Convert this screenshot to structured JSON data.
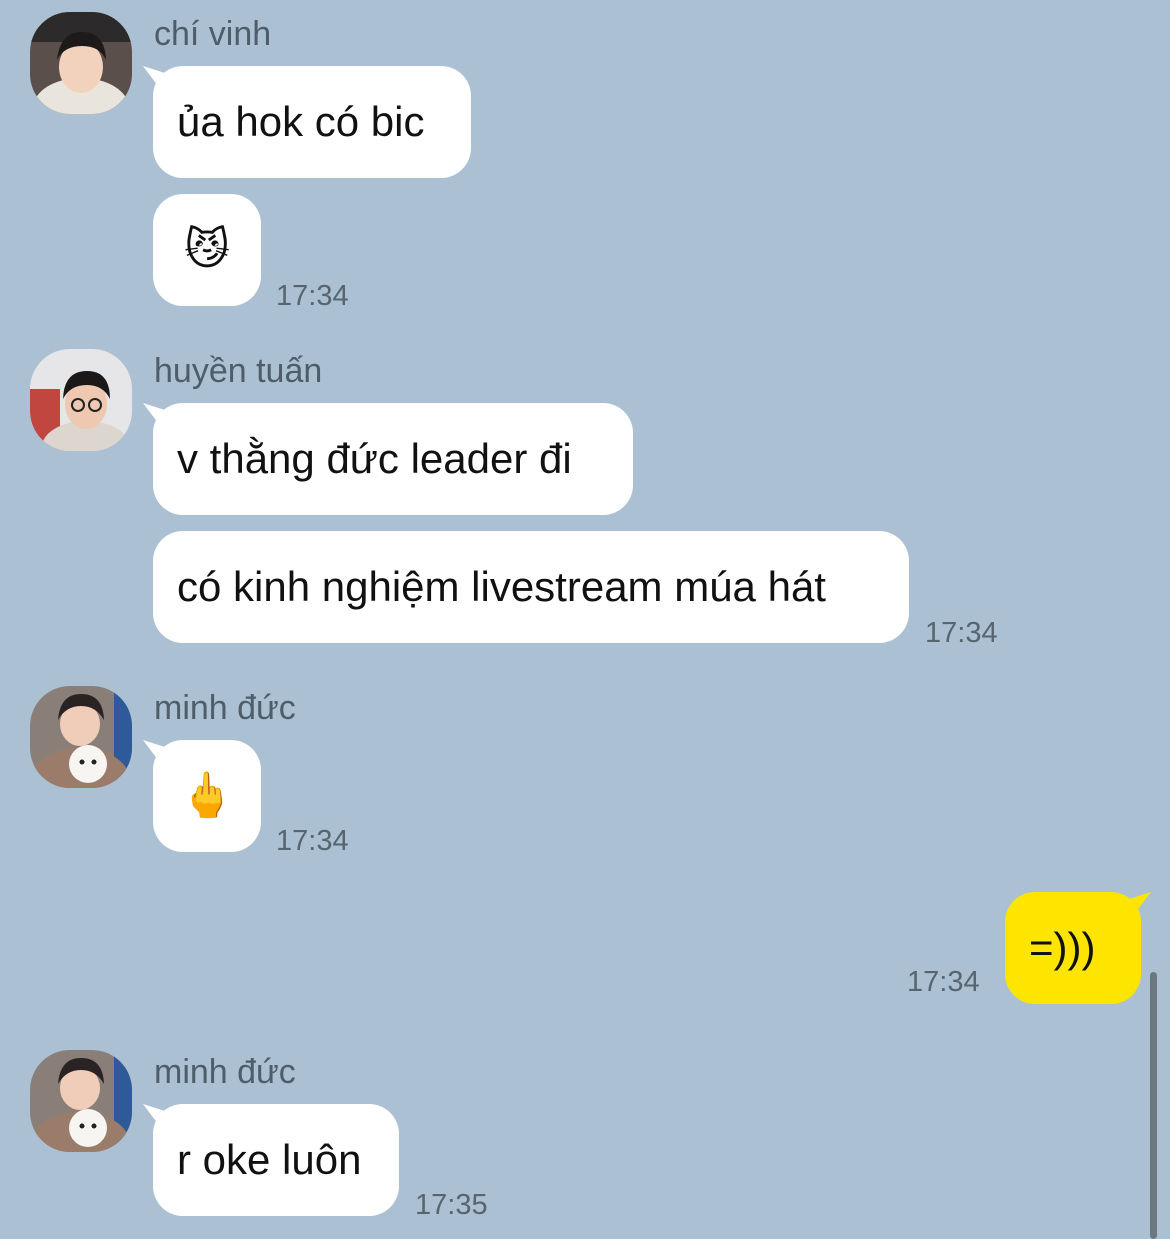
{
  "messages": [
    {
      "sender": "chí vinh",
      "avatar": "avatar-chi-vinh",
      "bubbles": [
        {
          "text": "ủa hok có bic"
        },
        {
          "text": "😼",
          "emoji": "smirking-cat-emoji"
        }
      ],
      "time": "17:34"
    },
    {
      "sender": "huyền tuấn",
      "avatar": "avatar-huyen-tuan",
      "bubbles": [
        {
          "text": "v thằng đức leader đi"
        },
        {
          "text": "có kinh nghiệm livestream múa hát"
        }
      ],
      "time": "17:34"
    },
    {
      "sender": "minh đức",
      "avatar": "avatar-minh-duc",
      "bubbles": [
        {
          "text": "🖕",
          "emoji": "middle-finger-emoji"
        }
      ],
      "time": "17:34"
    },
    {
      "sender": "me",
      "bubbles": [
        {
          "text": "=)))"
        }
      ],
      "time": "17:34"
    },
    {
      "sender": "minh đức",
      "avatar": "avatar-minh-duc",
      "bubbles": [
        {
          "text": "r oke luôn"
        }
      ],
      "time": "17:35"
    }
  ],
  "colors": {
    "background": "#abc1d3",
    "incoming_bubble": "#ffffff",
    "outgoing_bubble": "#fee500",
    "timestamp": "#57656f",
    "sender_name": "#4e5d6a"
  }
}
